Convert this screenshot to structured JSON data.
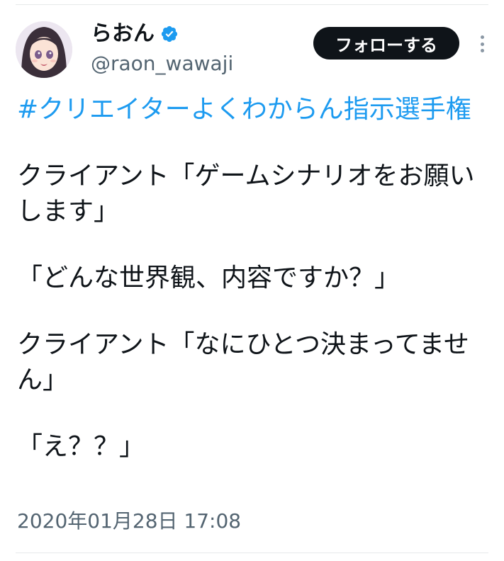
{
  "user": {
    "display_name": "らおん",
    "handle": "@raon_wawaji",
    "verified": true
  },
  "follow_button_label": "フォローする",
  "tweet": {
    "hashtag": "#クリエイターよくわからん指示選手権",
    "paragraphs": [
      "クライアント「ゲームシナリオをお願いします」",
      "「どんな世界観、内容ですか？」",
      "クライアント「なにひとつ決まってません」",
      "「え？？」"
    ],
    "timestamp": "2020年01月28日 17:08"
  },
  "colors": {
    "accent": "#1d9bf0",
    "text": "#0f1419",
    "secondary_text": "#536471",
    "follow_button_bg": "#0f1419"
  }
}
